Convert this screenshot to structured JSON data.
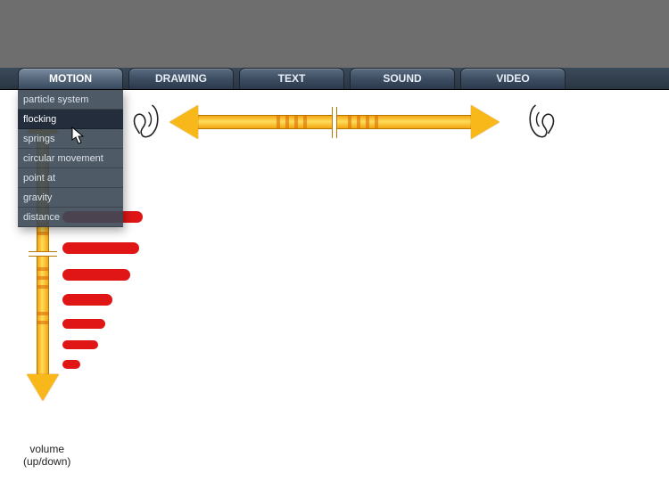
{
  "tabs": [
    {
      "label": "MOTION",
      "active": true
    },
    {
      "label": "DRAWING",
      "active": false
    },
    {
      "label": "TEXT",
      "active": false
    },
    {
      "label": "SOUND",
      "active": false
    },
    {
      "label": "VIDEO",
      "active": false
    }
  ],
  "motion_menu": {
    "items": [
      "particle system",
      "flocking",
      "springs",
      "circular movement",
      "point at",
      "gravity",
      "distance"
    ],
    "hover_index": 1
  },
  "labels": {
    "volume_line1": "volume",
    "volume_line2": "(up/down)"
  }
}
